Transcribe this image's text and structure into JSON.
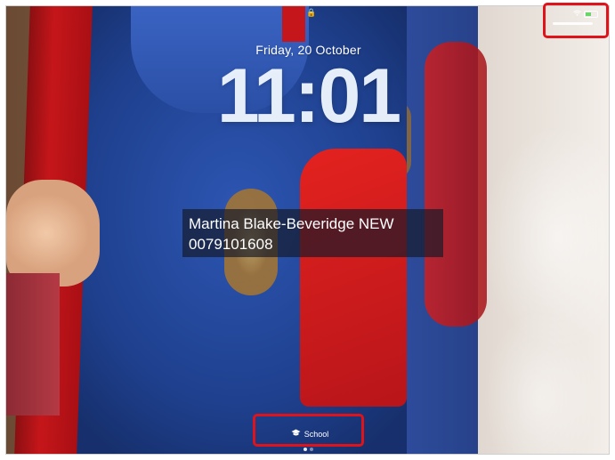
{
  "lock_screen": {
    "date": "Friday, 20 October",
    "time": "11:01",
    "lock_symbol": "🔒"
  },
  "message": {
    "line1": "Martina Blake-Beveridge NEW",
    "line2": "0079101608"
  },
  "focus": {
    "label": "School",
    "icon": "graduation-cap-icon"
  },
  "status_bar": {
    "icons": [
      "wifi-icon",
      "battery-icon"
    ],
    "battery_color": "#6bd46b"
  },
  "annotations": {
    "color": "#e0121a",
    "targets": [
      "status-bar",
      "focus-mode"
    ]
  },
  "page_indicator": {
    "pages": 2,
    "current": 1
  }
}
